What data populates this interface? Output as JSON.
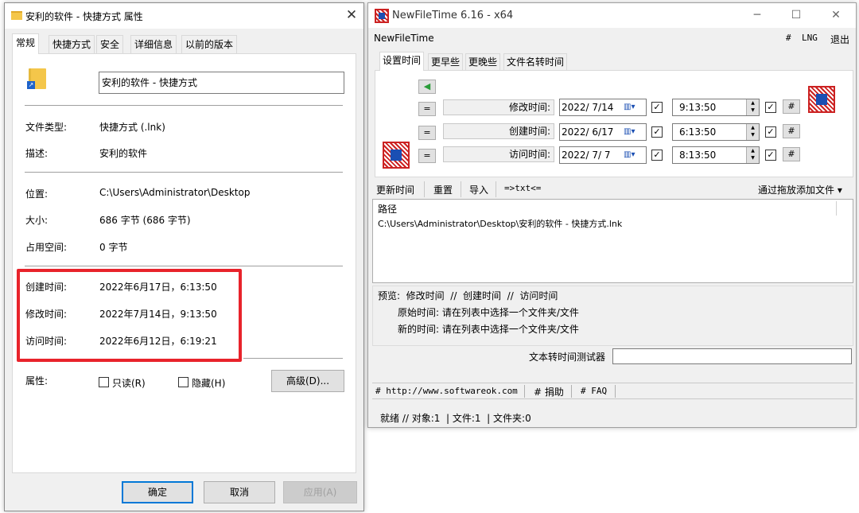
{
  "props": {
    "title": "安利的软件 - 快捷方式 属性",
    "close": "✕",
    "tabs": [
      "常规",
      "快捷方式",
      "安全",
      "详细信息",
      "以前的版本"
    ],
    "name_value": "安利的软件 - 快捷方式",
    "rows": {
      "type_label": "文件类型:",
      "type_value": "快捷方式 (.lnk)",
      "desc_label": "描述:",
      "desc_value": "安利的软件",
      "loc_label": "位置:",
      "loc_value": "C:\\Users\\Administrator\\Desktop",
      "size_label": "大小:",
      "size_value": "686 字节 (686 字节)",
      "disk_label": "占用空间:",
      "disk_value": "0 字节",
      "created_label": "创建时间:",
      "created_value": "2022年6月17日，6:13:50",
      "modified_label": "修改时间:",
      "modified_value": "2022年7月14日，9:13:50",
      "accessed_label": "访问时间:",
      "accessed_value": "2022年6月12日，6:19:21",
      "attr_label": "属性:",
      "readonly_label": "只读(R)",
      "hidden_label": "隐藏(H)",
      "advanced_label": "高级(D)..."
    },
    "buttons": {
      "ok": "确定",
      "cancel": "取消",
      "apply": "应用(A)"
    },
    "highlight_color": "#e8232b"
  },
  "nft": {
    "title": "NewFileTime 6.16 - x64",
    "menu_left": "NewFileTime",
    "menu_hash": "#",
    "menu_lng": "LNG",
    "menu_exit": "退出",
    "tabs": [
      "设置时间",
      "更早些",
      "更晚些",
      "文件名转时间"
    ],
    "rows": [
      {
        "label": "修改时间:",
        "date": "2022/ 7/14",
        "time": "9:13:50"
      },
      {
        "label": "创建时间:",
        "date": "2022/ 6/17",
        "time": "6:13:50"
      },
      {
        "label": "访问时间:",
        "date": "2022/ 7/ 7",
        "time": "8:13:50"
      }
    ],
    "eq": "=",
    "hash": "#",
    "toolbar": {
      "update": "更新时间",
      "reset": "重置",
      "import": "导入",
      "txt": "=>txt<=",
      "drag": "通过拖放添加文件 ▾"
    },
    "list": {
      "header": "路径",
      "item": "C:\\Users\\Administrator\\Desktop\\安利的软件 - 快捷方式.lnk"
    },
    "preview": {
      "line": "预览:  修改时间  //  创建时间  //  访问时间",
      "orig": "原始时间: 请在列表中选择一个文件夹/文件",
      "new": "新的时间: 请在列表中选择一个文件夹/文件"
    },
    "tester_label": "文本转时间测试器",
    "links": {
      "site": "# http://www.softwareok.com",
      "donate": "# 捐助",
      "faq": "# FAQ"
    },
    "status": "就绪 // 对象:1  | 文件:1  | 文件夹:0"
  }
}
